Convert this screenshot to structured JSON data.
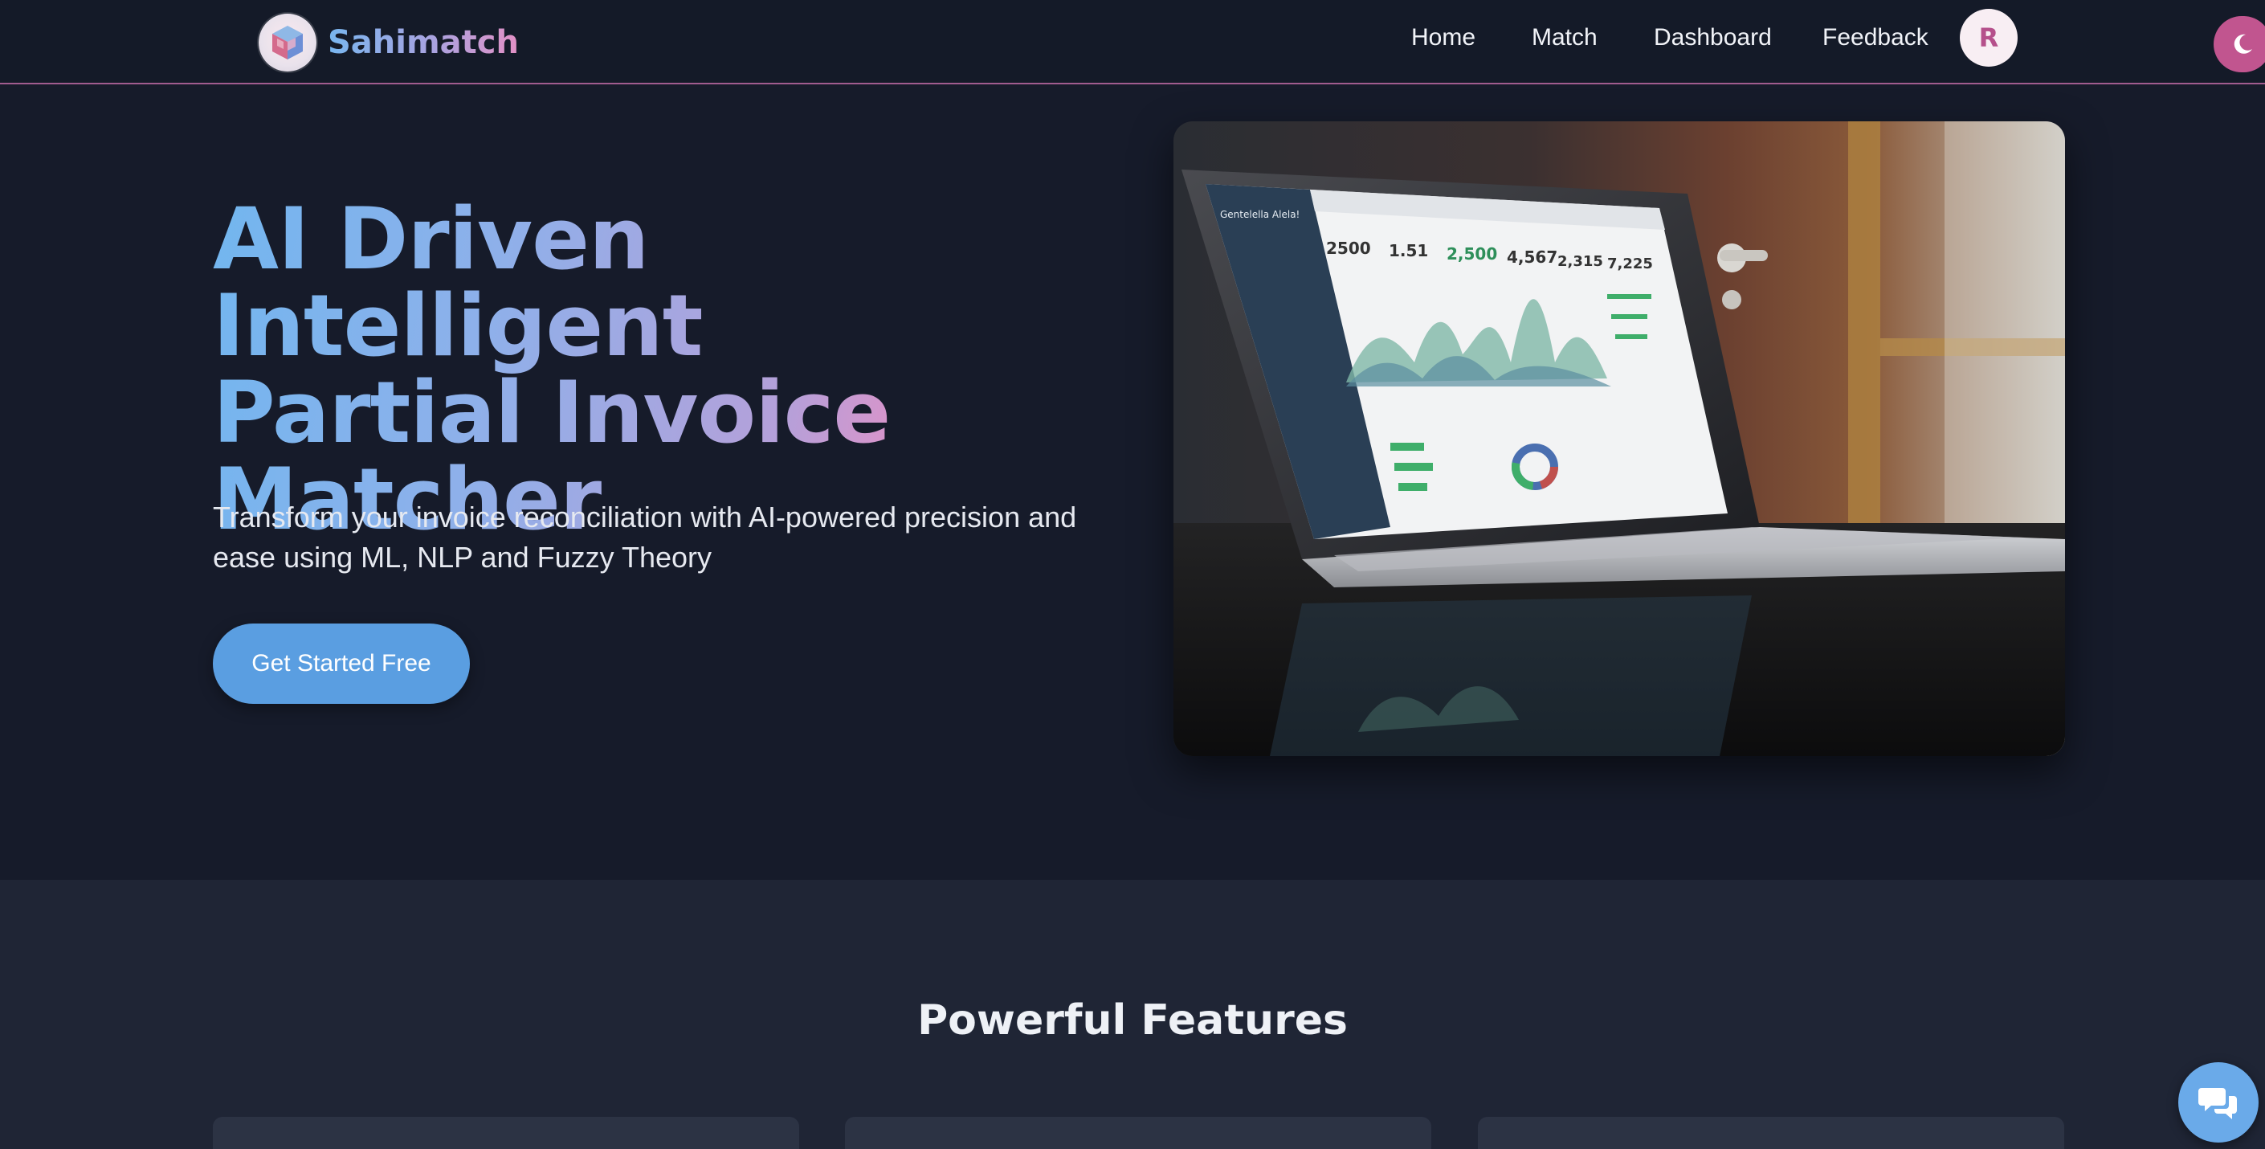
{
  "brand": {
    "name": "Sahimatch",
    "logo_icon": "cube-logo-icon"
  },
  "nav": {
    "links": [
      {
        "label": "Home"
      },
      {
        "label": "Match"
      },
      {
        "label": "Dashboard"
      },
      {
        "label": "Feedback"
      }
    ],
    "avatar_initial": "R",
    "theme_toggle_icon": "moon-icon"
  },
  "hero": {
    "title_lines": [
      "AI Driven Intelligent",
      "Partial Invoice",
      "Matcher"
    ],
    "subtitle": "Transform your invoice reconciliation with AI-powered precision and ease using ML, NLP and Fuzzy Theory",
    "cta_label": "Get Started Free",
    "image": {
      "icon": "laptop-dashboard-photo",
      "stats": [
        "2500",
        "1.51",
        "2,500",
        "4,567",
        "2,315",
        "7,225"
      ],
      "window_title": "Gentelella Alela!"
    }
  },
  "features": {
    "title": "Powerful Features"
  },
  "chat": {
    "icon": "chat-bubbles-icon"
  },
  "colors": {
    "background": "#161b2a",
    "nav_border": "#a15c8f",
    "accent_blue": "#5a9ee1",
    "accent_pink": "#c1558f",
    "gradient_start": "#72b6ef",
    "gradient_end": "#e690c5"
  }
}
